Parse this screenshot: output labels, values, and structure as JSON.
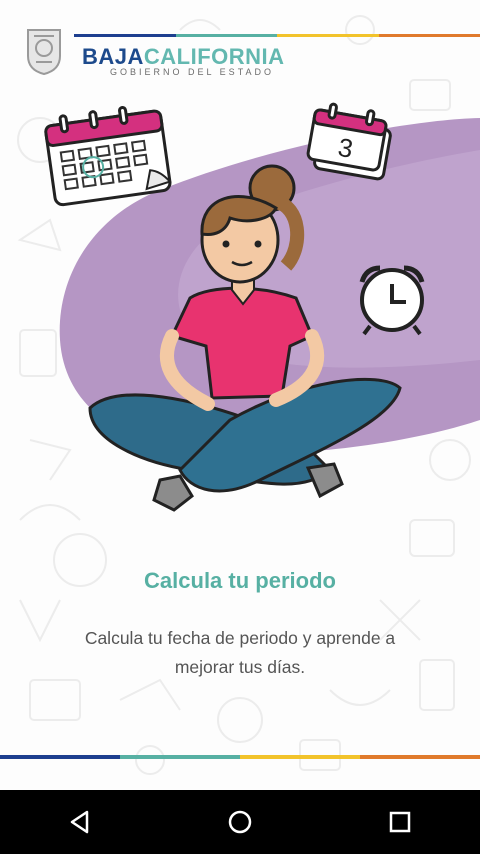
{
  "brand": {
    "name_part1": "BAJA",
    "name_part2": "CALIFORNIA",
    "subtitle": "GOBIERNO DEL ESTADO"
  },
  "calendar_day": "3",
  "content": {
    "title": "Calcula tu periodo",
    "description": "Calcula tu fecha de periodo y aprende a mejorar tus días."
  },
  "colors": {
    "accent_teal": "#57b0a3",
    "brand_blue": "#1d4a8c",
    "stripe": [
      "#1d3f8f",
      "#57b0a3",
      "#f2c32b",
      "#e07a2c"
    ],
    "blob_purple": "#b596c4"
  },
  "nav": {
    "back_icon": "back-triangle-icon",
    "home_icon": "home-circle-icon",
    "recents_icon": "recents-square-icon"
  }
}
